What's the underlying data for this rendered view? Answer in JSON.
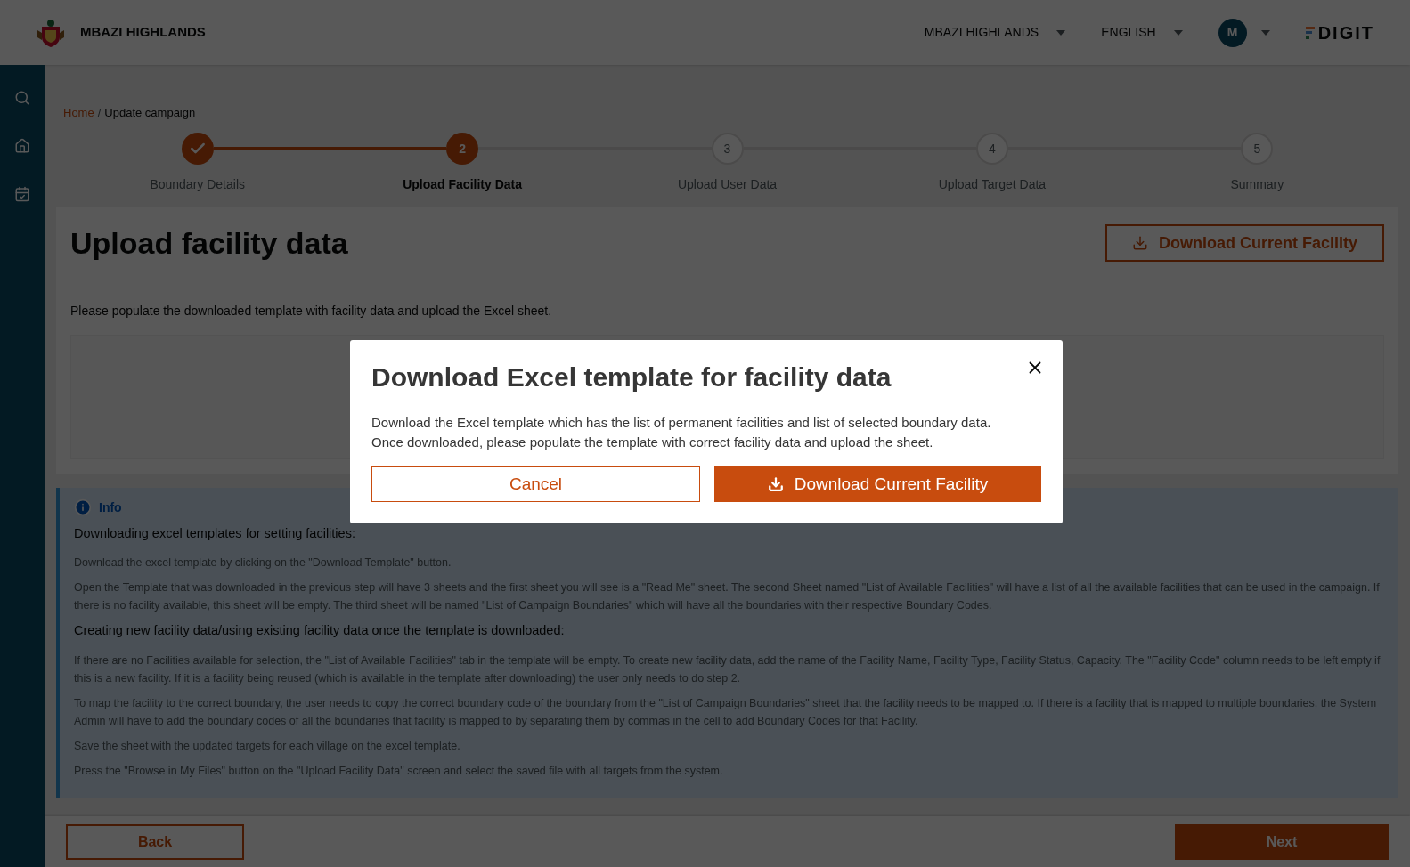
{
  "header": {
    "title": "MBAZI HIGHLANDS",
    "tenant_dropdown": "MBAZI HIGHLANDS",
    "language_dropdown": "ENGLISH",
    "avatar_initial": "M",
    "brand": "DIGIT"
  },
  "breadcrumb": {
    "items": [
      "Home",
      "Update campaign"
    ],
    "separator": "/"
  },
  "stepper": [
    {
      "label": "Boundary Details",
      "completed": true,
      "selected": false
    },
    {
      "label": "Upload Facility Data",
      "number": "2",
      "completed": false,
      "selected": true
    },
    {
      "label": "Upload User Data",
      "number": "3",
      "completed": false,
      "selected": false
    },
    {
      "label": "Upload Target Data",
      "number": "4",
      "completed": false,
      "selected": false
    },
    {
      "label": "Summary",
      "number": "5",
      "completed": false,
      "selected": false
    }
  ],
  "page": {
    "title": "Upload facility data",
    "download_button": "Download Current Facility",
    "description": "Please populate the downloaded template with facility data and upload the Excel sheet."
  },
  "info": {
    "title": "Info",
    "sections": [
      {
        "heading": "Downloading excel templates for setting facilities:",
        "paragraphs": [
          "Download the excel template by clicking on the \"Download Template\" button.",
          "Open the Template that was downloaded in the previous step will have 3 sheets and the first sheet you will see is a \"Read Me\" sheet. The second Sheet named \"List of Available Facilities\" will have a list of all the available facilities that can be used in the campaign. If there is no facility available, this sheet will be empty. The third sheet will be named \"List of Campaign Boundaries\" which will have all the boundaries with their respective Boundary Codes."
        ]
      },
      {
        "heading": "Creating new facility data/using existing facility data once the template is downloaded:",
        "paragraphs": [
          "If there are no Facilities available for selection, the \"List of Available Facilities\" tab in the template will be empty. To create new facility data, add the name of the Facility Name, Facility Type, Facility Status, Capacity. The \"Facility Code\" column needs to be left empty if this is a new facility. If it is a facility being reused (which is available in the template after downloading) the user only needs to do step 2.",
          "To map the facility to the correct boundary, the user needs to copy the correct boundary code of the boundary from the \"List of Campaign Boundaries\" sheet that the facility needs to be mapped to. If there is a facility that is mapped to multiple boundaries, the System Admin will have to add the boundary codes of all the boundaries that facility is mapped to by separating them by commas in the cell to add Boundary Codes for that Facility.",
          "Save the sheet with the updated targets for each village on the excel template.",
          "Press the \"Browse in My Files\" button on the \"Upload Facility Data\" screen and select the saved file with all targets from the system."
        ]
      }
    ]
  },
  "footer": {
    "back": "Back",
    "next": "Next"
  },
  "modal": {
    "title": "Download Excel template for facility data",
    "body": [
      "Download the Excel template which has the list of permanent facilities and list of selected boundary data.",
      "Once downloaded, please populate the template with correct facility data and upload the sheet."
    ],
    "cancel": "Cancel",
    "confirm": "Download Current Facility"
  }
}
